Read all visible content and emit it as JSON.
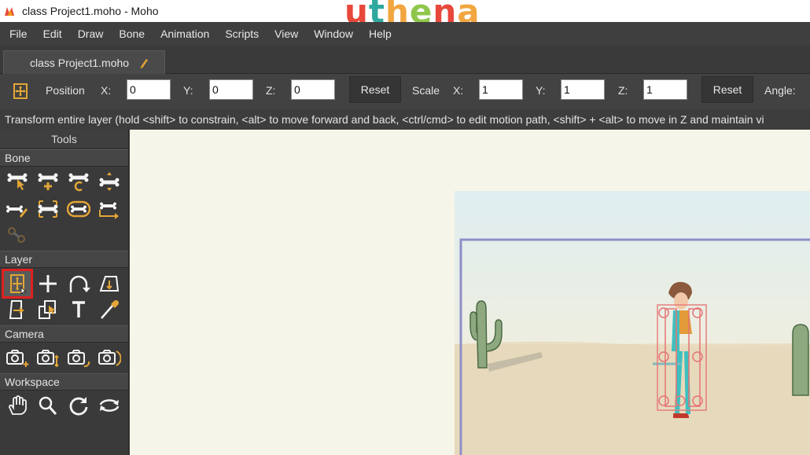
{
  "window": {
    "title": "class Project1.moho - Moho",
    "watermark": [
      "u",
      "t",
      "h",
      "e",
      "n",
      "a"
    ],
    "watermark_colors": [
      "#e8483b",
      "#2fa8a0",
      "#f2a640",
      "#8fc74a",
      "#e8483b",
      "#f2a640"
    ]
  },
  "menu": [
    "File",
    "Edit",
    "Draw",
    "Bone",
    "Animation",
    "Scripts",
    "View",
    "Window",
    "Help"
  ],
  "doc_tab": {
    "label": "class Project1.moho"
  },
  "options": {
    "position_label": "Position",
    "x_label": "X:",
    "y_label": "Y:",
    "z_label": "Z:",
    "pos_x": "0",
    "pos_y": "0",
    "pos_z": "0",
    "reset_label": "Reset",
    "scale_label": "Scale",
    "scale_x": "1",
    "scale_y": "1",
    "scale_z": "1",
    "angle_label": "Angle:"
  },
  "hint": "Transform entire layer (hold <shift> to constrain, <alt> to move forward and back, <ctrl/cmd> to edit motion path, <shift> + <alt> to move in Z and maintain vi",
  "tools_panel": {
    "title": "Tools",
    "sections": {
      "bone": "Bone",
      "layer": "Layer",
      "camera": "Camera",
      "workspace": "Workspace"
    },
    "selected_tool": "transform-layer"
  },
  "colors": {
    "accent_gold": "#e3a637",
    "selection_red": "#e02020",
    "canvas_bg": "#f6f5e9",
    "frame_border": "#8e8fc8"
  }
}
